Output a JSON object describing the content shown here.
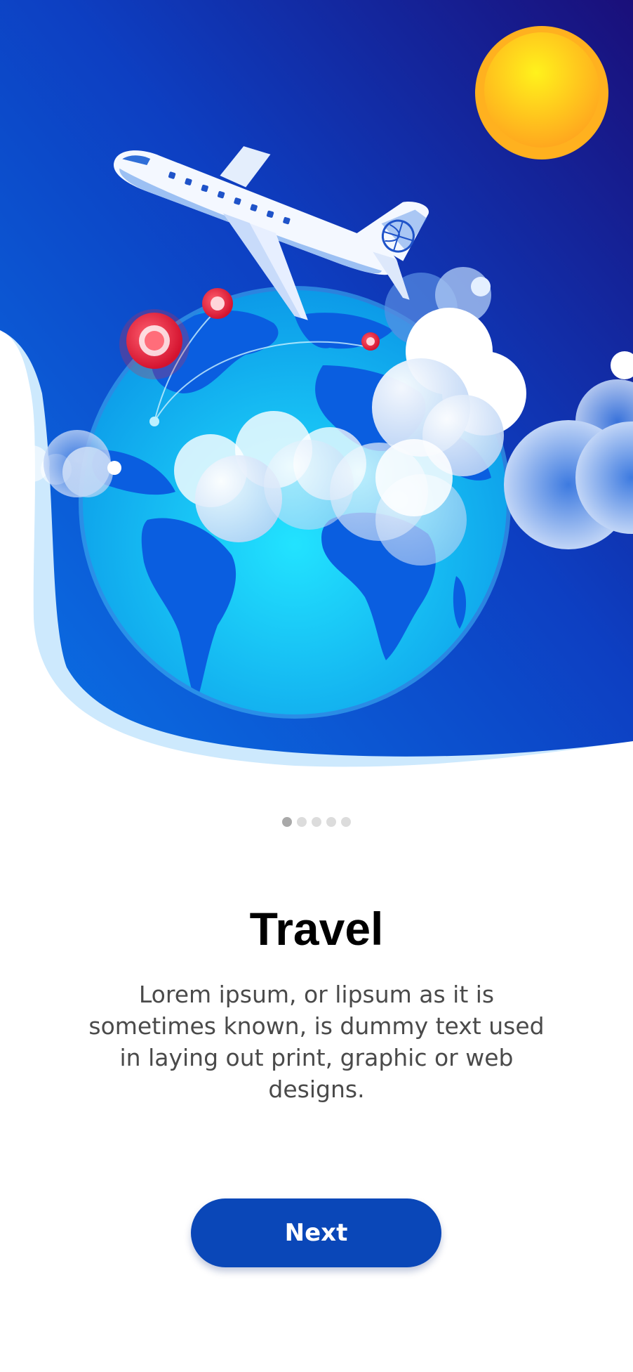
{
  "onboarding": {
    "illustration_icon": "travel-globe-airplane-illustration",
    "pager": {
      "total": 5,
      "active_index": 0
    },
    "title": "Travel",
    "description": "Lorem ipsum, or lipsum as it is sometimes known, is dummy text used in laying out print, graphic or web designs.",
    "next_label": "Next"
  },
  "colors": {
    "sky_dark": "#1a0f7a",
    "sky_light": "#0a6fe0",
    "globe": "#18c6f0",
    "continents": "#0a5ee0",
    "sun": "#ffc21a",
    "pin": "#e8243c",
    "button": "#0a47b8",
    "title_text": "#000000",
    "body_text": "#4a4a4a"
  }
}
